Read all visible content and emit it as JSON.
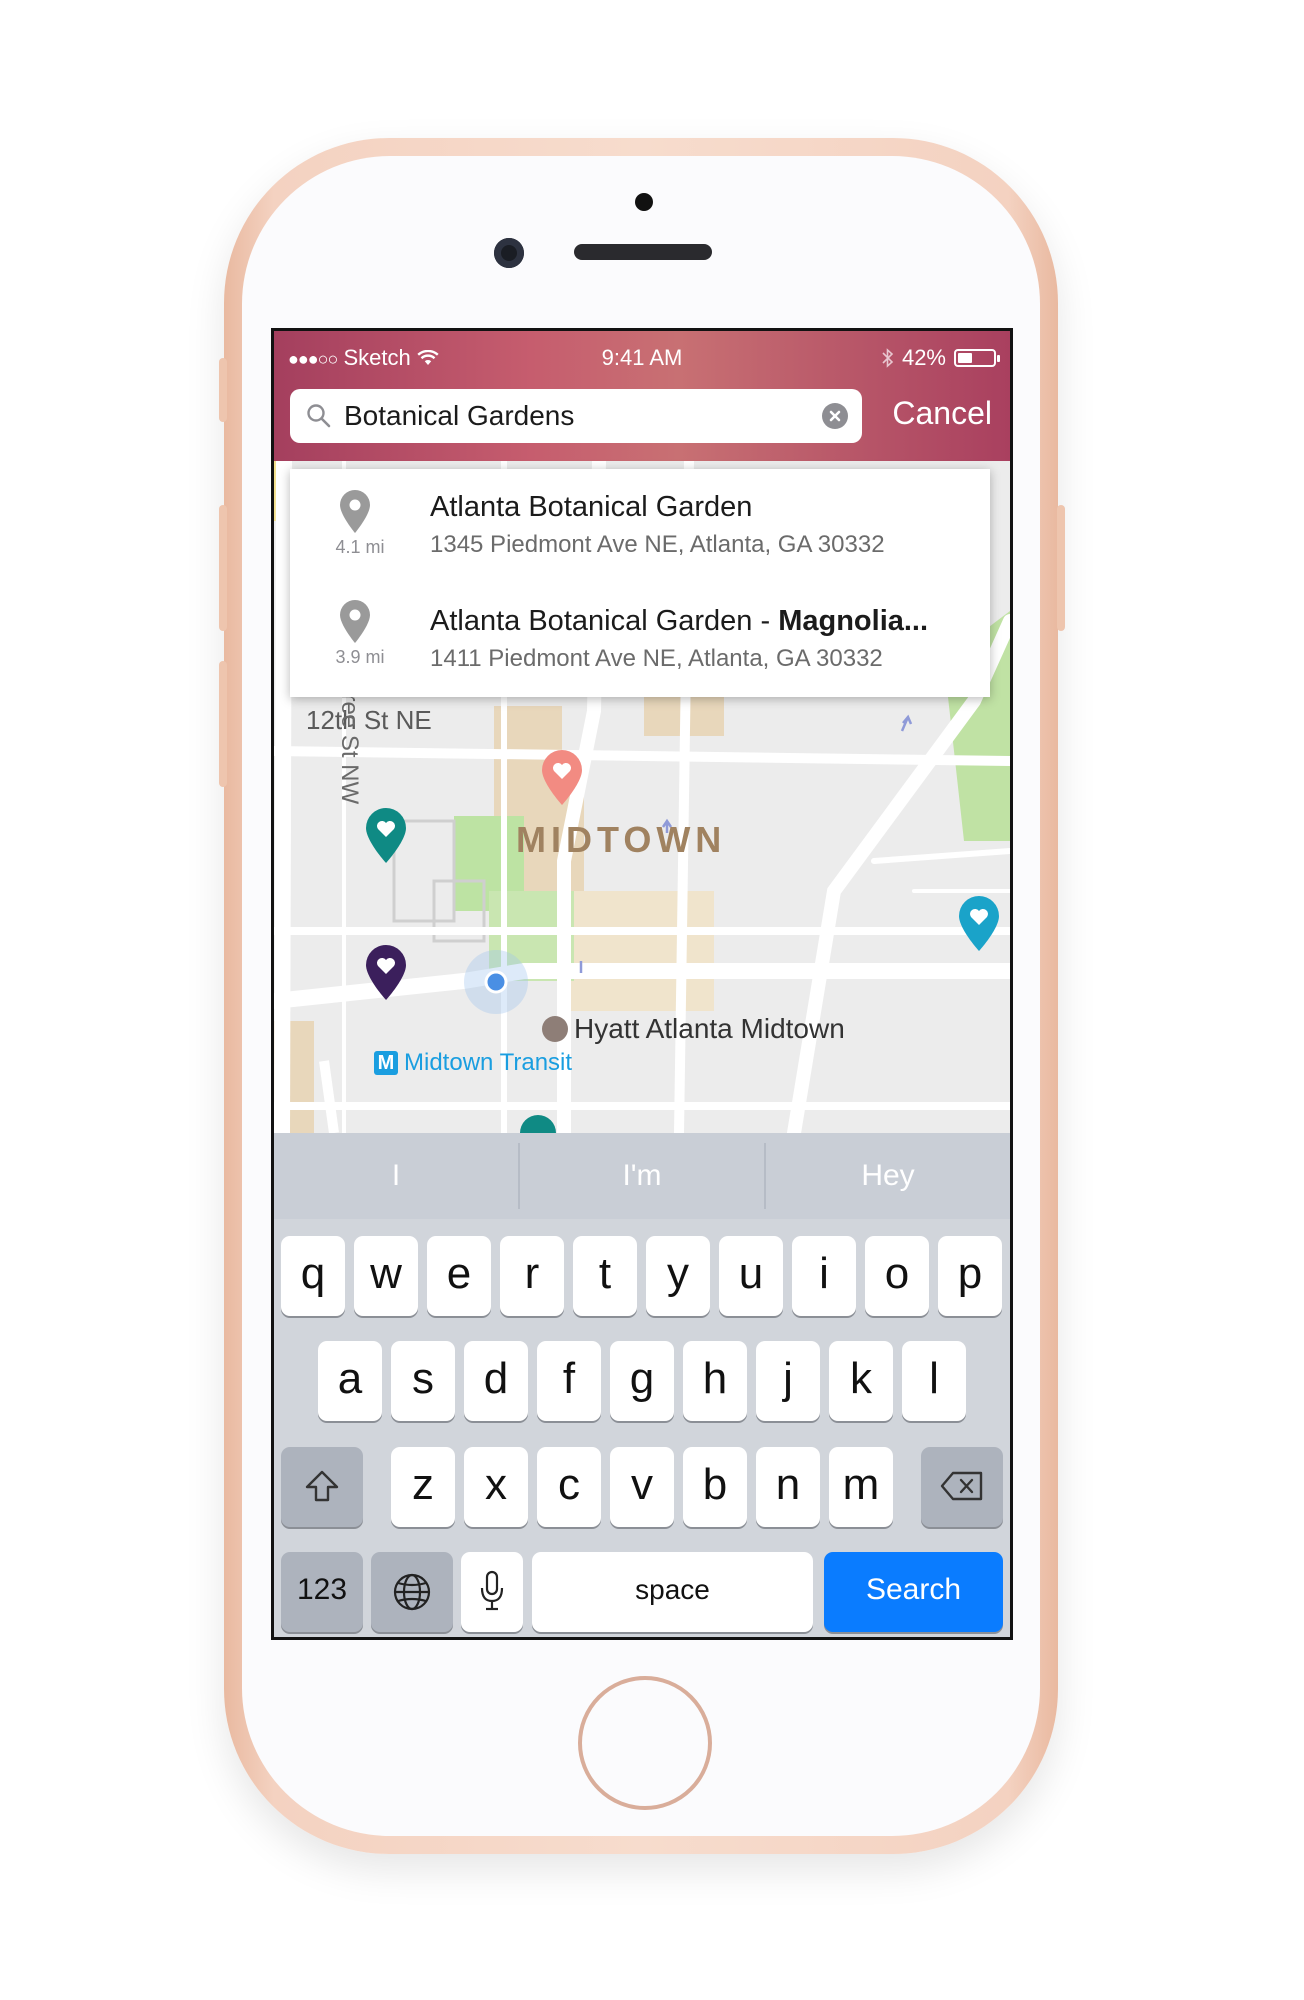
{
  "status_bar": {
    "signal": "●●●○○",
    "carrier": "Sketch",
    "time": "9:41 AM",
    "battery_percent": "42%",
    "battery_level": 0.42
  },
  "search": {
    "value": "Botanical Gardens",
    "cancel_label": "Cancel"
  },
  "suggestions": [
    {
      "distance": "4.1 mi",
      "title": "Atlanta Botanical Garden",
      "title_bold": "",
      "address": "1345 Piedmont Ave NE, Atlanta, GA 30332"
    },
    {
      "distance": "3.9 mi",
      "title": "Atlanta Botanical Garden - ",
      "title_bold": "Magnolia...",
      "address": "1411 Piedmont Ave NE, Atlanta, GA 30332"
    }
  ],
  "map": {
    "street_12th": "12th St NE",
    "street_peachtree": "West Peachtree St NW",
    "district": "MIDTOWN",
    "hotel": "Hyatt Atlanta Midtown",
    "transit_badge": "M",
    "transit": "Midtown Transit",
    "pin_colors": {
      "coral": "#f28b82",
      "teal": "#0f8a84",
      "cyan": "#1aa3c9",
      "purple": "#3b1f5c"
    }
  },
  "keyboard": {
    "predictions": [
      "I",
      "I'm",
      "Hey"
    ],
    "row1": [
      "q",
      "w",
      "e",
      "r",
      "t",
      "y",
      "u",
      "i",
      "o",
      "p"
    ],
    "row2": [
      "a",
      "s",
      "d",
      "f",
      "g",
      "h",
      "j",
      "k",
      "l"
    ],
    "row3": [
      "z",
      "x",
      "c",
      "v",
      "b",
      "n",
      "m"
    ],
    "numbers_label": "123",
    "space_label": "space",
    "search_label": "Search",
    "icons": {
      "shift": "shift-icon",
      "delete": "delete-icon",
      "globe": "globe-icon",
      "mic": "microphone-icon"
    }
  },
  "colors": {
    "header_gradient_start": "#a43f5e",
    "header_gradient_mid": "#c87073",
    "search_key": "#0a7cff"
  }
}
